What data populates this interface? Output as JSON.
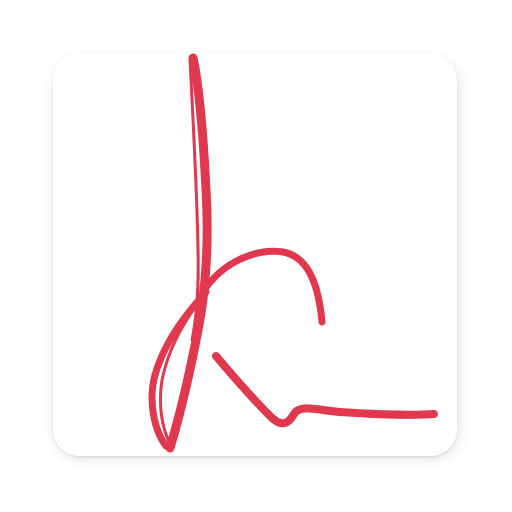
{
  "app_icon": {
    "logo_name": "signature-k-logo",
    "background_color": "#ffffff",
    "stroke_color": "#e0384f"
  }
}
